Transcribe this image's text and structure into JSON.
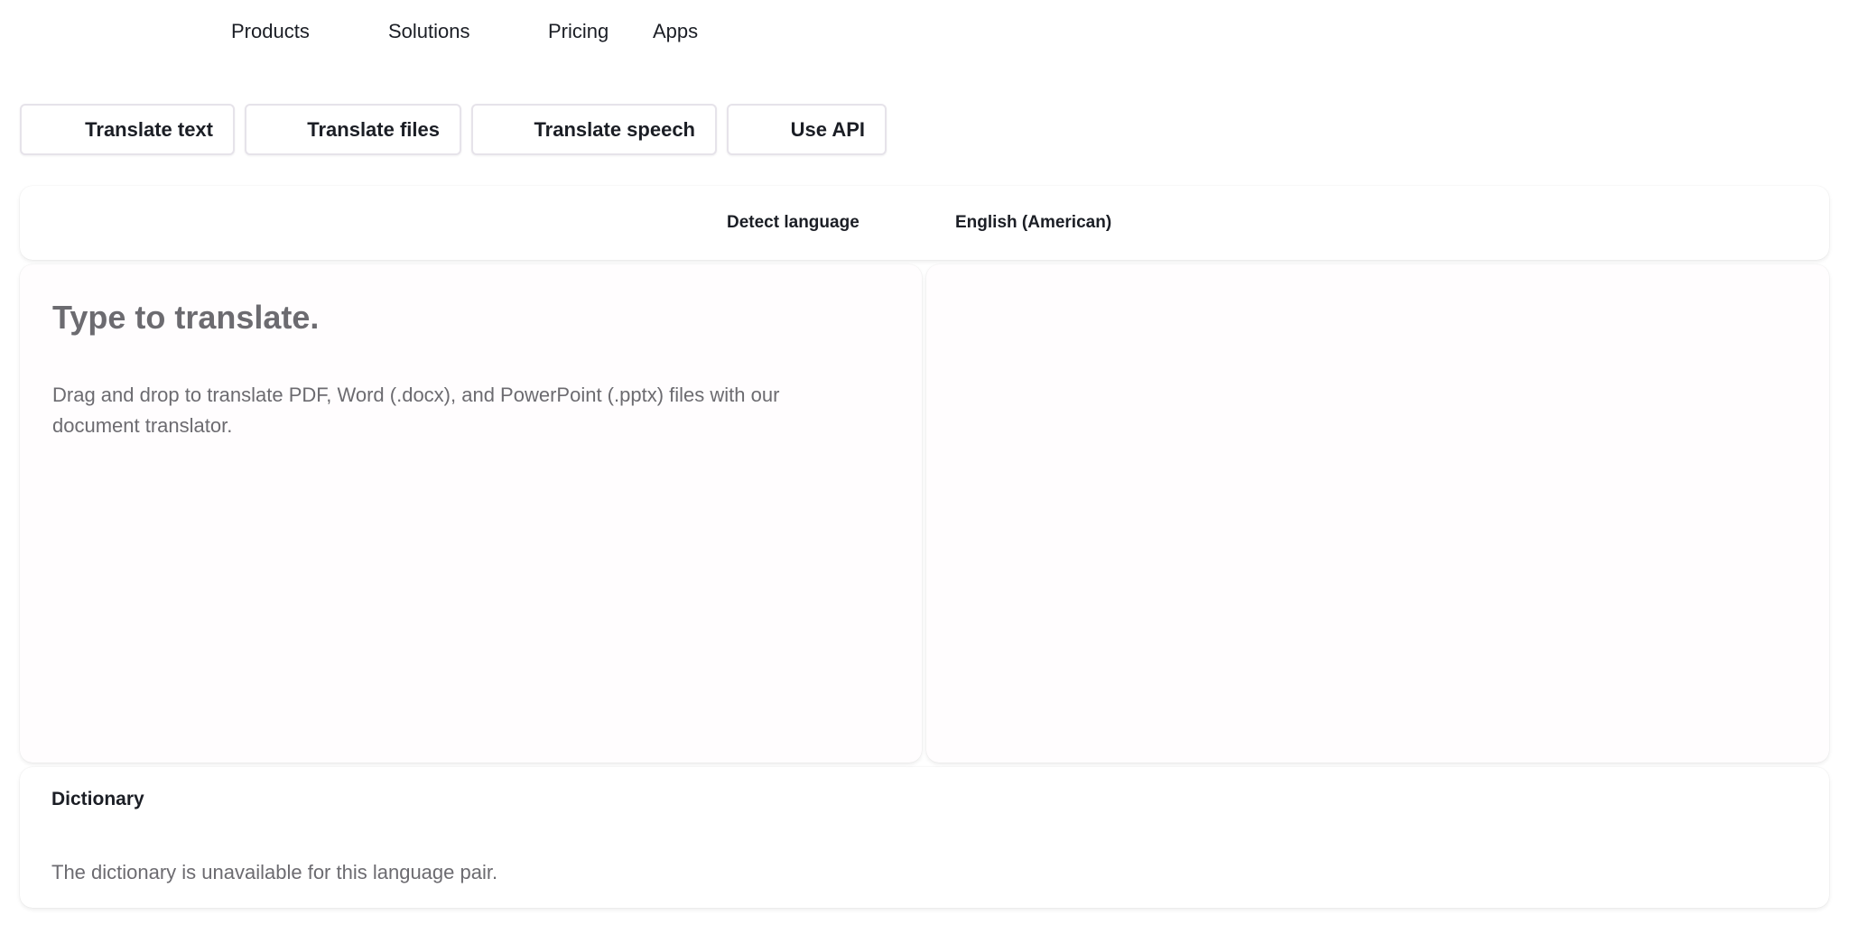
{
  "nav": {
    "products": "Products",
    "solutions": "Solutions",
    "pricing": "Pricing",
    "apps": "Apps"
  },
  "modes": {
    "translate_text": "Translate text",
    "translate_files": "Translate files",
    "translate_speech": "Translate speech",
    "use_api": "Use API"
  },
  "languages": {
    "source": "Detect language",
    "target": "English (American)"
  },
  "source_panel": {
    "placeholder": "Type to translate.",
    "drop_hint": "Drag and drop to translate PDF, Word (.docx), and PowerPoint (.pptx) files with our document translator."
  },
  "dictionary": {
    "title": "Dictionary",
    "message": "The dictionary is unavailable for this language pair."
  }
}
